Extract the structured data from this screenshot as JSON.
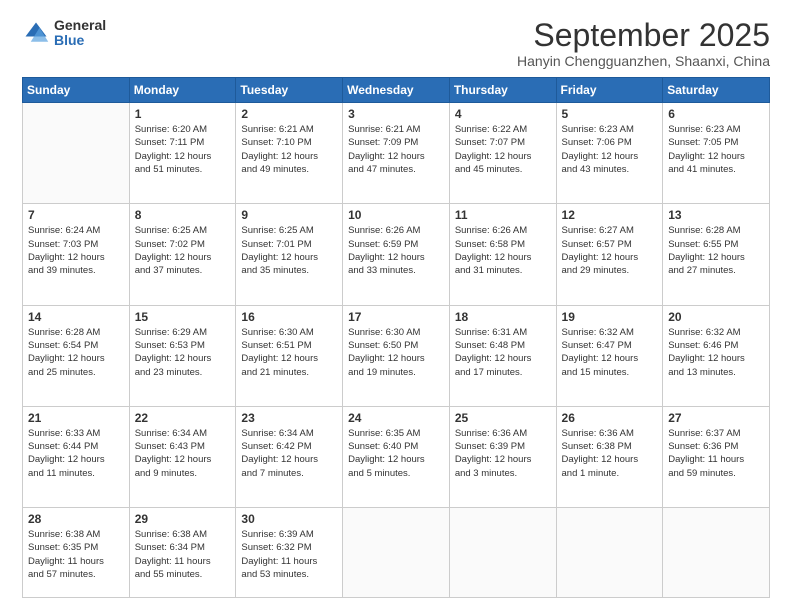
{
  "logo": {
    "general": "General",
    "blue": "Blue"
  },
  "header": {
    "month": "September 2025",
    "location": "Hanyin Chengguanzhen, Shaanxi, China"
  },
  "weekdays": [
    "Sunday",
    "Monday",
    "Tuesday",
    "Wednesday",
    "Thursday",
    "Friday",
    "Saturday"
  ],
  "weeks": [
    [
      {
        "day": "",
        "info": ""
      },
      {
        "day": "1",
        "info": "Sunrise: 6:20 AM\nSunset: 7:11 PM\nDaylight: 12 hours\nand 51 minutes."
      },
      {
        "day": "2",
        "info": "Sunrise: 6:21 AM\nSunset: 7:10 PM\nDaylight: 12 hours\nand 49 minutes."
      },
      {
        "day": "3",
        "info": "Sunrise: 6:21 AM\nSunset: 7:09 PM\nDaylight: 12 hours\nand 47 minutes."
      },
      {
        "day": "4",
        "info": "Sunrise: 6:22 AM\nSunset: 7:07 PM\nDaylight: 12 hours\nand 45 minutes."
      },
      {
        "day": "5",
        "info": "Sunrise: 6:23 AM\nSunset: 7:06 PM\nDaylight: 12 hours\nand 43 minutes."
      },
      {
        "day": "6",
        "info": "Sunrise: 6:23 AM\nSunset: 7:05 PM\nDaylight: 12 hours\nand 41 minutes."
      }
    ],
    [
      {
        "day": "7",
        "info": "Sunrise: 6:24 AM\nSunset: 7:03 PM\nDaylight: 12 hours\nand 39 minutes."
      },
      {
        "day": "8",
        "info": "Sunrise: 6:25 AM\nSunset: 7:02 PM\nDaylight: 12 hours\nand 37 minutes."
      },
      {
        "day": "9",
        "info": "Sunrise: 6:25 AM\nSunset: 7:01 PM\nDaylight: 12 hours\nand 35 minutes."
      },
      {
        "day": "10",
        "info": "Sunrise: 6:26 AM\nSunset: 6:59 PM\nDaylight: 12 hours\nand 33 minutes."
      },
      {
        "day": "11",
        "info": "Sunrise: 6:26 AM\nSunset: 6:58 PM\nDaylight: 12 hours\nand 31 minutes."
      },
      {
        "day": "12",
        "info": "Sunrise: 6:27 AM\nSunset: 6:57 PM\nDaylight: 12 hours\nand 29 minutes."
      },
      {
        "day": "13",
        "info": "Sunrise: 6:28 AM\nSunset: 6:55 PM\nDaylight: 12 hours\nand 27 minutes."
      }
    ],
    [
      {
        "day": "14",
        "info": "Sunrise: 6:28 AM\nSunset: 6:54 PM\nDaylight: 12 hours\nand 25 minutes."
      },
      {
        "day": "15",
        "info": "Sunrise: 6:29 AM\nSunset: 6:53 PM\nDaylight: 12 hours\nand 23 minutes."
      },
      {
        "day": "16",
        "info": "Sunrise: 6:30 AM\nSunset: 6:51 PM\nDaylight: 12 hours\nand 21 minutes."
      },
      {
        "day": "17",
        "info": "Sunrise: 6:30 AM\nSunset: 6:50 PM\nDaylight: 12 hours\nand 19 minutes."
      },
      {
        "day": "18",
        "info": "Sunrise: 6:31 AM\nSunset: 6:48 PM\nDaylight: 12 hours\nand 17 minutes."
      },
      {
        "day": "19",
        "info": "Sunrise: 6:32 AM\nSunset: 6:47 PM\nDaylight: 12 hours\nand 15 minutes."
      },
      {
        "day": "20",
        "info": "Sunrise: 6:32 AM\nSunset: 6:46 PM\nDaylight: 12 hours\nand 13 minutes."
      }
    ],
    [
      {
        "day": "21",
        "info": "Sunrise: 6:33 AM\nSunset: 6:44 PM\nDaylight: 12 hours\nand 11 minutes."
      },
      {
        "day": "22",
        "info": "Sunrise: 6:34 AM\nSunset: 6:43 PM\nDaylight: 12 hours\nand 9 minutes."
      },
      {
        "day": "23",
        "info": "Sunrise: 6:34 AM\nSunset: 6:42 PM\nDaylight: 12 hours\nand 7 minutes."
      },
      {
        "day": "24",
        "info": "Sunrise: 6:35 AM\nSunset: 6:40 PM\nDaylight: 12 hours\nand 5 minutes."
      },
      {
        "day": "25",
        "info": "Sunrise: 6:36 AM\nSunset: 6:39 PM\nDaylight: 12 hours\nand 3 minutes."
      },
      {
        "day": "26",
        "info": "Sunrise: 6:36 AM\nSunset: 6:38 PM\nDaylight: 12 hours\nand 1 minute."
      },
      {
        "day": "27",
        "info": "Sunrise: 6:37 AM\nSunset: 6:36 PM\nDaylight: 11 hours\nand 59 minutes."
      }
    ],
    [
      {
        "day": "28",
        "info": "Sunrise: 6:38 AM\nSunset: 6:35 PM\nDaylight: 11 hours\nand 57 minutes."
      },
      {
        "day": "29",
        "info": "Sunrise: 6:38 AM\nSunset: 6:34 PM\nDaylight: 11 hours\nand 55 minutes."
      },
      {
        "day": "30",
        "info": "Sunrise: 6:39 AM\nSunset: 6:32 PM\nDaylight: 11 hours\nand 53 minutes."
      },
      {
        "day": "",
        "info": ""
      },
      {
        "day": "",
        "info": ""
      },
      {
        "day": "",
        "info": ""
      },
      {
        "day": "",
        "info": ""
      }
    ]
  ]
}
